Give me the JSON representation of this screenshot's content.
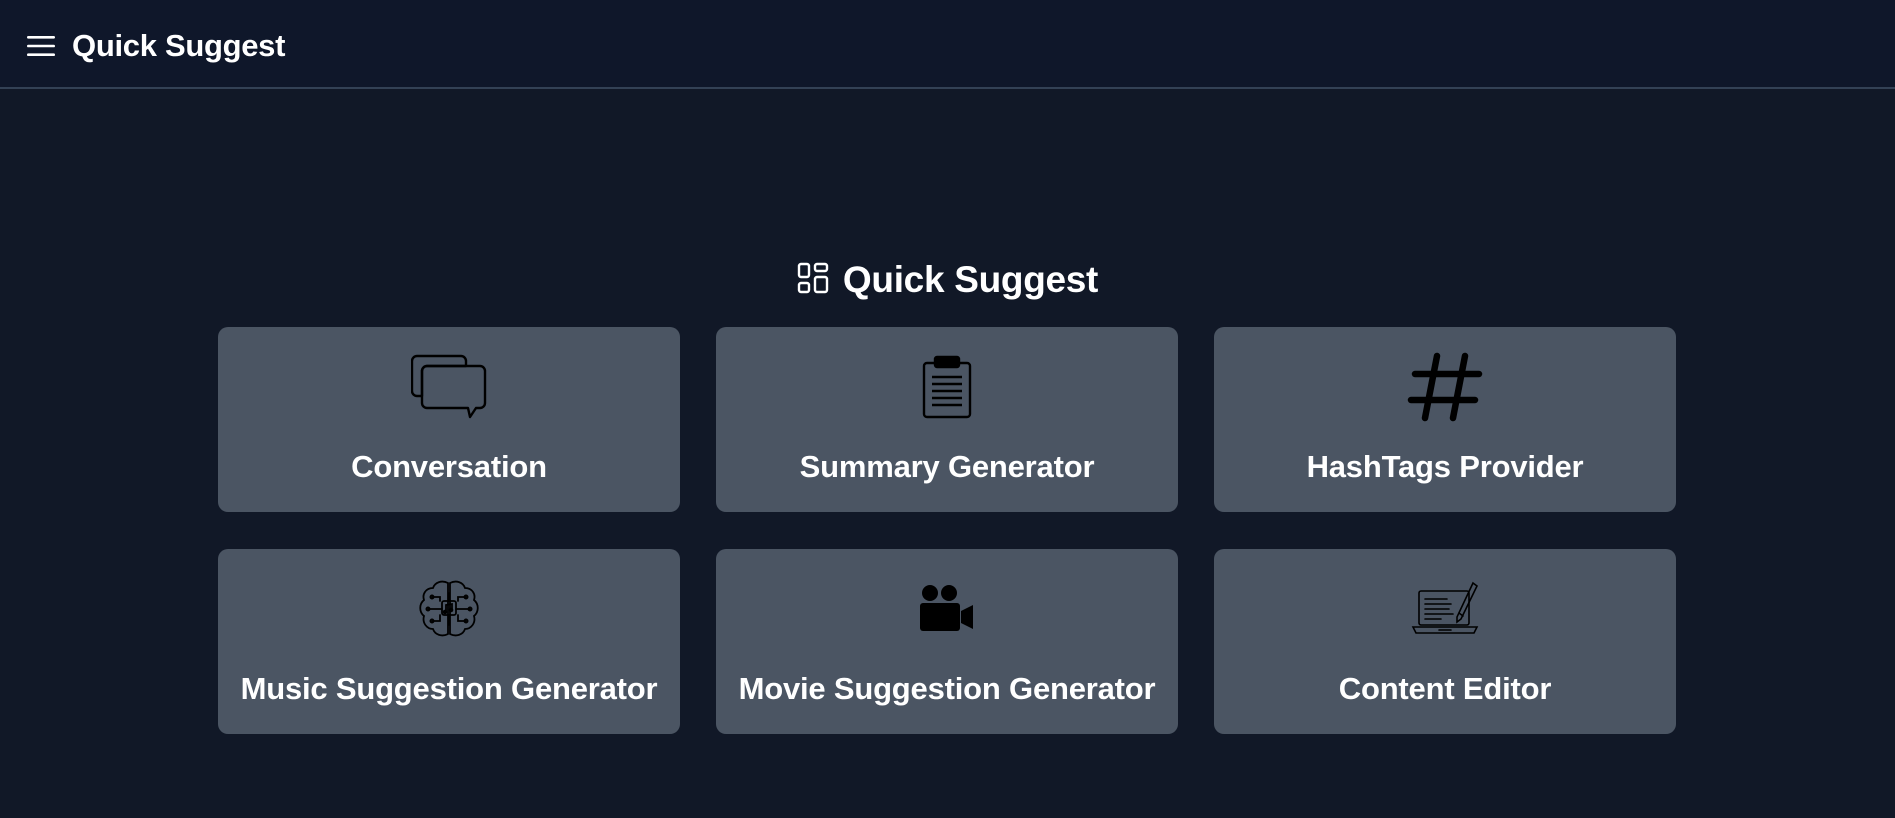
{
  "header": {
    "menu_icon": "hamburger-menu-icon",
    "title": "Quick Suggest"
  },
  "main": {
    "heading": {
      "icon": "dashboard-grid-icon",
      "label": "Quick Suggest"
    },
    "cards": [
      {
        "label": "Conversation",
        "icon": "chat-bubbles-icon"
      },
      {
        "label": "Summary Generator",
        "icon": "clipboard-icon"
      },
      {
        "label": "HashTags Provider",
        "icon": "hashtag-icon"
      },
      {
        "label": "Music Suggestion Generator",
        "icon": "brain-music-icon"
      },
      {
        "label": "Movie Suggestion Generator",
        "icon": "movie-camera-icon"
      },
      {
        "label": "Content Editor",
        "icon": "laptop-pen-icon"
      }
    ]
  },
  "colors": {
    "background": "#111827",
    "header_background": "#0f172a",
    "card_background": "#4b5563",
    "text": "#ffffff",
    "icon": "#000000"
  }
}
